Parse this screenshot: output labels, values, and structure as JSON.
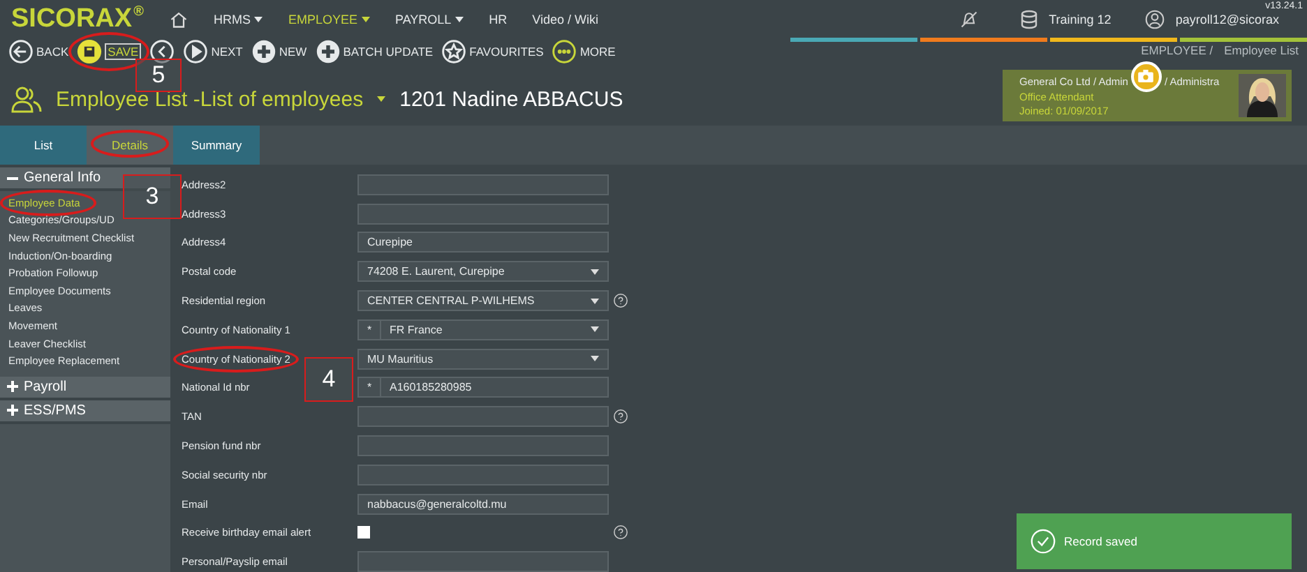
{
  "app": {
    "logo": "SICORAX",
    "logo_mark": "®",
    "version": "v13.24.1"
  },
  "top_menu": [
    {
      "label": "HRMS",
      "dropdown": true,
      "selected": false
    },
    {
      "label": "EMPLOYEE",
      "dropdown": true,
      "selected": true
    },
    {
      "label": "PAYROLL",
      "dropdown": true,
      "selected": false
    },
    {
      "label": "HR",
      "dropdown": false,
      "selected": false
    },
    {
      "label": "Video / Wiki",
      "dropdown": false,
      "selected": false
    }
  ],
  "user_area": {
    "database": "Training 12",
    "user": "payroll12@sicorax"
  },
  "toolbar": [
    {
      "kind": "back",
      "label": "BACK",
      "highlighted": false
    },
    {
      "kind": "save",
      "label": "SAVE",
      "highlighted": true
    },
    {
      "kind": "prev",
      "highlighted": false
    },
    {
      "kind": "next",
      "label": "NEXT",
      "highlighted": false
    },
    {
      "kind": "add",
      "label": "NEW",
      "highlighted": false
    },
    {
      "kind": "add",
      "label": "BATCH UPDATE",
      "highlighted": false
    },
    {
      "kind": "star",
      "label": "FAVOURITES",
      "highlighted": false
    },
    {
      "kind": "more",
      "label": "MORE",
      "highlighted": false
    }
  ],
  "breadcrumb": [
    "EMPLOYEE /",
    "Employee List"
  ],
  "page_title": {
    "title": "Employee List -List of employees",
    "record": "1201 Nadine ABBACUS"
  },
  "profile_card": {
    "org_start": "General Co Ltd / Admin",
    "org_end": "/ Administra",
    "position": "Office Attendant",
    "joined": "Joined: 01/09/2017"
  },
  "tabs": [
    {
      "label": "List",
      "selected": false,
      "highlighted": false
    },
    {
      "label": "Details",
      "selected": true,
      "highlighted": true
    },
    {
      "label": "Summary",
      "selected": false,
      "highlighted": false
    }
  ],
  "sidebar": [
    {
      "label": "General Info",
      "expanded": true,
      "items": [
        {
          "label": "Employee Data",
          "selected": true,
          "highlighted": true
        },
        {
          "label": "Categories/Groups/UD",
          "selected": false,
          "highlighted": false
        },
        {
          "label": "New Recruitment Checklist",
          "selected": false,
          "highlighted": false
        },
        {
          "label": "Induction/On-boarding",
          "selected": false,
          "highlighted": false
        },
        {
          "label": "Probation Followup",
          "selected": false,
          "highlighted": false
        },
        {
          "label": "Employee Documents",
          "selected": false,
          "highlighted": false
        },
        {
          "label": "Leaves",
          "selected": false,
          "highlighted": false
        },
        {
          "label": "Movement",
          "selected": false,
          "highlighted": false
        },
        {
          "label": "Leaver Checklist",
          "selected": false,
          "highlighted": false
        },
        {
          "label": "Employee Replacement",
          "selected": false,
          "highlighted": false
        }
      ]
    },
    {
      "label": "Payroll",
      "expanded": false
    },
    {
      "label": "ESS/PMS",
      "expanded": false
    }
  ],
  "form": [
    {
      "label": "Address2",
      "kind": "text",
      "help": false,
      "highlighted": false
    },
    {
      "label": "Address3",
      "kind": "text",
      "help": false,
      "highlighted": false
    },
    {
      "label": "Address4",
      "kind": "text",
      "value": "Curepipe",
      "help": false,
      "highlighted": false
    },
    {
      "label": "Postal code",
      "kind": "select",
      "value": "74208 E. Laurent, Curepipe",
      "help": false,
      "highlighted": false
    },
    {
      "label": "Residential region",
      "kind": "select",
      "value": "CENTER CENTRAL P-WILHEMS",
      "help": true,
      "highlighted": false
    },
    {
      "label": "Country of Nationality 1",
      "kind": "select",
      "prefix": "*",
      "value": "FR France",
      "help": false,
      "highlighted": false
    },
    {
      "label": "Country of Nationality 2",
      "kind": "select",
      "value": "MU Mauritius",
      "help": false,
      "highlighted": true
    },
    {
      "label": "National Id nbr",
      "kind": "text",
      "prefix": "*",
      "value": "A160185280985",
      "help": false,
      "highlighted": false
    },
    {
      "label": "TAN",
      "kind": "text",
      "help": true,
      "highlighted": false
    },
    {
      "label": "Pension fund nbr",
      "kind": "text",
      "help": false,
      "highlighted": false
    },
    {
      "label": "Social security nbr",
      "kind": "text",
      "help": false,
      "highlighted": false
    },
    {
      "label": "Email",
      "kind": "text",
      "value": "nabbacus@generalcoltd.mu",
      "help": false,
      "highlighted": false
    },
    {
      "label": "Receive birthday email alert",
      "kind": "checkbox",
      "checked": false,
      "help": true,
      "highlighted": false
    },
    {
      "label": "Personal/Payslip email",
      "kind": "text",
      "help": false,
      "highlighted": false
    }
  ],
  "toast": {
    "message": "Record saved"
  },
  "annotations": [
    {
      "label": "5"
    },
    {
      "label": "3"
    },
    {
      "label": "4"
    }
  ]
}
